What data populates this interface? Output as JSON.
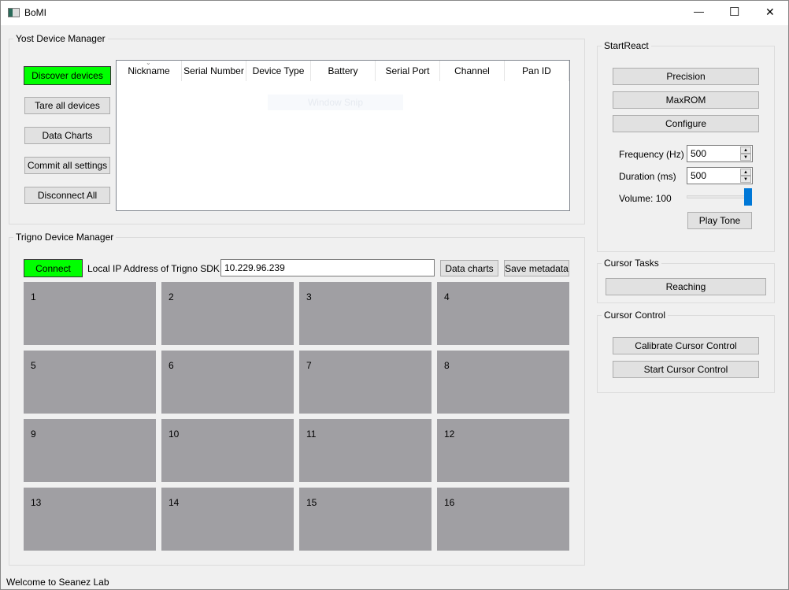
{
  "window": {
    "title": "BoMI",
    "minimize": "—",
    "maximize": "☐",
    "close": "✕"
  },
  "yost": {
    "title": "Yost Device Manager",
    "buttons": [
      "Discover devices",
      "Tare all devices",
      "Data Charts",
      "Commit all settings",
      "Disconnect All"
    ],
    "columns": [
      "Nickname",
      "Serial Number",
      "Device Type",
      "Battery",
      "Serial Port",
      "Channel",
      "Pan ID"
    ],
    "overlay": "Window Snip"
  },
  "trigno": {
    "title": "Trigno Device Manager",
    "connect": "Connect",
    "ip_label": "Local IP Address of Trigno SDK:",
    "ip_value": "10.229.96.239",
    "data_charts": "Data charts",
    "save_metadata": "Save metadata",
    "tiles": [
      "1",
      "2",
      "3",
      "4",
      "5",
      "6",
      "7",
      "8",
      "9",
      "10",
      "11",
      "12",
      "13",
      "14",
      "15",
      "16"
    ]
  },
  "startreact": {
    "title": "StartReact",
    "buttons": [
      "Precision",
      "MaxROM",
      "Configure"
    ],
    "frequency_label": "Frequency (Hz)",
    "frequency_value": "500",
    "duration_label": "Duration (ms)",
    "duration_value": "500",
    "volume_label": "Volume: 100",
    "volume_value": 100,
    "play_tone": "Play Tone"
  },
  "cursor_tasks": {
    "title": "Cursor Tasks",
    "reaching": "Reaching"
  },
  "cursor_control": {
    "title": "Cursor Control",
    "calibrate": "Calibrate Cursor Control",
    "start": "Start Cursor Control"
  },
  "status": "Welcome to Seanez Lab",
  "colors": {
    "accent_green": "#00ff00",
    "tile_gray": "#a09fa3",
    "slider_blue": "#0078d7"
  }
}
